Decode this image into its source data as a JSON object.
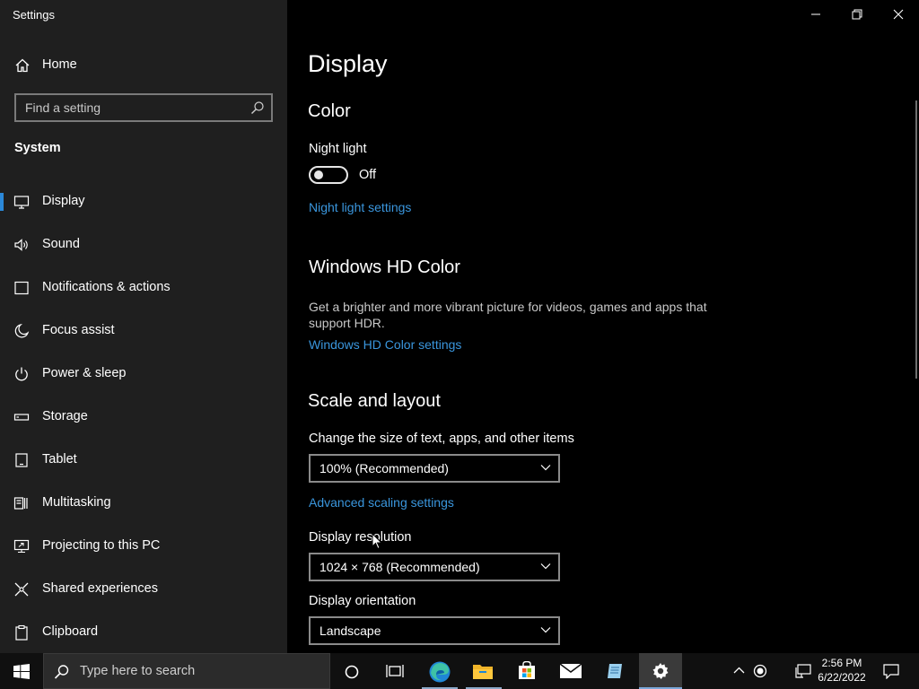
{
  "window": {
    "title": "Settings",
    "controls": [
      "minimize-icon",
      "restore-icon",
      "close-icon"
    ]
  },
  "sidebar": {
    "home_label": "Home",
    "search_placeholder": "Find a setting",
    "section": "System",
    "items": [
      {
        "label": "Display",
        "icon": "monitor-icon",
        "active": true
      },
      {
        "label": "Sound",
        "icon": "speaker-icon"
      },
      {
        "label": "Notifications & actions",
        "icon": "notification-icon"
      },
      {
        "label": "Focus assist",
        "icon": "moon-icon"
      },
      {
        "label": "Power & sleep",
        "icon": "power-icon"
      },
      {
        "label": "Storage",
        "icon": "storage-icon"
      },
      {
        "label": "Tablet",
        "icon": "tablet-icon"
      },
      {
        "label": "Multitasking",
        "icon": "multitasking-icon"
      },
      {
        "label": "Projecting to this PC",
        "icon": "projecting-icon"
      },
      {
        "label": "Shared experiences",
        "icon": "shared-experiences-icon"
      },
      {
        "label": "Clipboard",
        "icon": "clipboard-icon"
      }
    ]
  },
  "main": {
    "page_title": "Display",
    "color": {
      "heading": "Color",
      "night_light_label": "Night light",
      "night_light_state": "Off",
      "night_light_on": false,
      "night_light_link": "Night light settings"
    },
    "hdr": {
      "heading": "Windows HD Color",
      "description": "Get a brighter and more vibrant picture for videos, games and apps that support HDR.",
      "link": "Windows HD Color settings"
    },
    "scale": {
      "heading": "Scale and layout",
      "size_label": "Change the size of text, apps, and other items",
      "size_value": "100% (Recommended)",
      "advanced_link": "Advanced scaling settings",
      "resolution_label": "Display resolution",
      "resolution_value": "1024 × 768 (Recommended)",
      "orientation_label": "Display orientation",
      "orientation_value": "Landscape"
    }
  },
  "taskbar": {
    "search_placeholder": "Type here to search",
    "time": "2:56 PM",
    "date": "6/22/2022",
    "apps": [
      "cortana-icon",
      "task-view-icon",
      "edge-icon",
      "file-explorer-icon",
      "store-icon",
      "mail-icon",
      "notepad-icon",
      "settings-icon"
    ],
    "active_app": "settings-icon"
  },
  "colors": {
    "sidebar_bg": "#1f1f1f",
    "main_bg": "#000000",
    "accent": "#2b88d8",
    "link": "#3a96dd",
    "taskbar_bg": "#101010"
  }
}
